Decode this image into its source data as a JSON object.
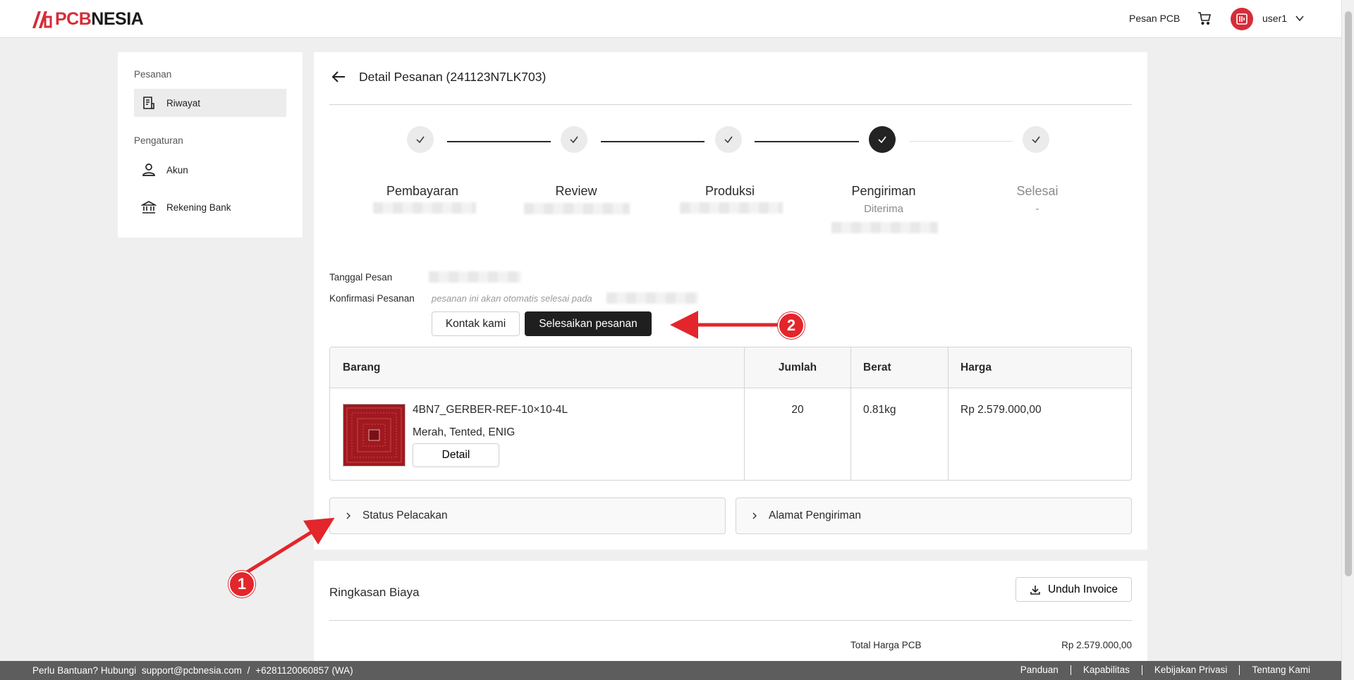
{
  "header": {
    "brand_pcb": "PCB",
    "brand_rest": "NESIA",
    "order_link": "Pesan PCB",
    "cart_icon": "cart-icon",
    "avatar_icon": "avatar-logo-icon",
    "user_name": "user1",
    "accent_color": "#d62d38"
  },
  "sidebar": {
    "group_orders": "Pesanan",
    "group_settings": "Pengaturan",
    "items": [
      {
        "label": "Riwayat",
        "icon": "receipt-icon",
        "active": true
      },
      {
        "label": "Akun",
        "icon": "user-icon",
        "active": false
      },
      {
        "label": "Rekening Bank",
        "icon": "bank-icon",
        "active": false
      }
    ]
  },
  "order": {
    "title": "Detail Pesanan (241123N7LK703)",
    "steps": [
      {
        "label": "Pembayaran",
        "state": "done"
      },
      {
        "label": "Review",
        "state": "done"
      },
      {
        "label": "Produksi",
        "state": "done"
      },
      {
        "label": "Pengiriman",
        "state": "current",
        "sub": "Diterima"
      },
      {
        "label": "Selesai",
        "state": "pending",
        "sub": "-"
      }
    ],
    "order_date_label": "Tanggal Pesan",
    "confirm_label": "Konfirmasi Pesanan",
    "confirm_note": "pesanan ini akan otomatis selesai pada",
    "contact_button": "Kontak kami",
    "finish_button": "Selesaikan pesanan"
  },
  "table": {
    "headers": [
      "Barang",
      "Jumlah",
      "Berat",
      "Harga"
    ],
    "rows": [
      {
        "name": "4BN7_GERBER-REF-10×10-4L",
        "spec": "Merah, Tented, ENIG",
        "detail_button": "Detail",
        "qty": "20",
        "weight": "0.81kg",
        "price": "Rp 2.579.000,00"
      }
    ]
  },
  "accordions": {
    "tracking": "Status Pelacakan",
    "shipping": "Alamat Pengiriman"
  },
  "summary": {
    "title": "Ringkasan Biaya",
    "invoice_button": "Unduh Invoice",
    "total_pcb_label": "Total Harga PCB",
    "total_pcb_value": "Rp 2.579.000,00"
  },
  "footer": {
    "help_text": "Perlu Bantuan? Hubungi",
    "email": "support@pcbnesia.com",
    "separator": "/",
    "phone": "+6281120060857 (WA)",
    "links": [
      "Panduan",
      "Kapabilitas",
      "Kebijakan Privasi",
      "Tentang Kami"
    ]
  },
  "annotations": {
    "badge_1": "1",
    "badge_2": "2",
    "color": "#e2262b"
  }
}
